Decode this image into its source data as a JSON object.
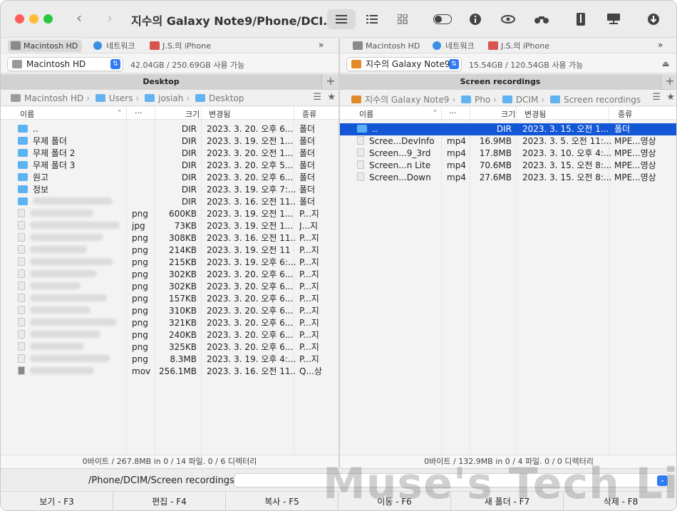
{
  "window": {
    "title": "지수의 Galaxy Note9/Phone/DCI..."
  },
  "colors": {
    "accent": "#1457d6",
    "folder": "#5cb3f2"
  },
  "toolbar": {
    "icons": [
      "list-view-icon",
      "detail-view-icon",
      "grid-view-icon",
      "toggle-icon",
      "info-icon",
      "eye-icon",
      "binoculars-icon",
      "archive-icon",
      "network-drive-icon",
      "download-icon"
    ]
  },
  "left": {
    "drives": [
      "Macintosh HD",
      "네트워크",
      "J.S.의 iPhone"
    ],
    "more": "»",
    "volume": "Macintosh HD",
    "space": "42.04GB / 250.69GB 사용 가능",
    "tab": "Desktop",
    "crumbs": [
      "Macintosh HD",
      "Users",
      "josiah",
      "Desktop"
    ],
    "headers": {
      "name": "이름",
      "ext": "···",
      "size": "크기",
      "modified": "변경됨",
      "kind": "종류"
    },
    "rows": [
      {
        "name": "..",
        "ext": "",
        "size": "DIR",
        "date": "2023. 3. 20. 오후 6...",
        "kind": "폴더",
        "type": "folder"
      },
      {
        "name": "무제 폴더",
        "ext": "",
        "size": "DIR",
        "date": "2023. 3. 19. 오전 1...",
        "kind": "폴더",
        "type": "folder"
      },
      {
        "name": "무제 폴더 2",
        "ext": "",
        "size": "DIR",
        "date": "2023. 3. 20. 오전 1...",
        "kind": "폴더",
        "type": "folder"
      },
      {
        "name": "무제 폴더 3",
        "ext": "",
        "size": "DIR",
        "date": "2023. 3. 20. 오후 5...",
        "kind": "폴더",
        "type": "folder"
      },
      {
        "name": "원고",
        "ext": "",
        "size": "DIR",
        "date": "2023. 3. 20. 오후 6...",
        "kind": "폴더",
        "type": "folder"
      },
      {
        "name": "정보",
        "ext": "",
        "size": "DIR",
        "date": "2023. 3. 19. 오후 7:...",
        "kind": "폴더",
        "type": "folder"
      },
      {
        "name": "",
        "ext": "",
        "size": "DIR",
        "date": "2023. 3. 16. 오전 11...",
        "kind": "폴더",
        "type": "folder-blur"
      },
      {
        "name": "",
        "ext": "png",
        "size": "600KB",
        "date": "2023. 3. 19. 오전 1...",
        "kind": "P...지",
        "type": "doc-blur"
      },
      {
        "name": "",
        "ext": "jpg",
        "size": "73KB",
        "date": "2023. 3. 19. 오전 1...",
        "kind": "J...지",
        "type": "doc-blur"
      },
      {
        "name": "",
        "ext": "png",
        "size": "308KB",
        "date": "2023. 3. 16. 오전 11...",
        "kind": "P...지",
        "type": "doc-blur"
      },
      {
        "name": "",
        "ext": "png",
        "size": "214KB",
        "date": "2023. 3. 19. 오전 11",
        "kind": "P...지",
        "type": "doc-blur"
      },
      {
        "name": "",
        "ext": "png",
        "size": "215KB",
        "date": "2023. 3. 19. 오후 6:...",
        "kind": "P...지",
        "type": "doc-blur"
      },
      {
        "name": "",
        "ext": "png",
        "size": "302KB",
        "date": "2023. 3. 20. 오후 6...",
        "kind": "P...지",
        "type": "doc-blur"
      },
      {
        "name": "",
        "ext": "png",
        "size": "302KB",
        "date": "2023. 3. 20. 오후 6...",
        "kind": "P...지",
        "type": "doc-blur"
      },
      {
        "name": "",
        "ext": "png",
        "size": "157KB",
        "date": "2023. 3. 20. 오후 6...",
        "kind": "P...지",
        "type": "doc-blur"
      },
      {
        "name": "",
        "ext": "png",
        "size": "310KB",
        "date": "2023. 3. 20. 오후 6...",
        "kind": "P...지",
        "type": "doc-blur"
      },
      {
        "name": "",
        "ext": "png",
        "size": "321KB",
        "date": "2023. 3. 20. 오후 6...",
        "kind": "P...지",
        "type": "doc-blur"
      },
      {
        "name": "",
        "ext": "png",
        "size": "240KB",
        "date": "2023. 3. 20. 오후 6...",
        "kind": "P...지",
        "type": "doc-blur"
      },
      {
        "name": "",
        "ext": "png",
        "size": "325KB",
        "date": "2023. 3. 20. 오후 6...",
        "kind": "P...지",
        "type": "doc-blur"
      },
      {
        "name": "",
        "ext": "png",
        "size": "8.3MB",
        "date": "2023. 3. 19. 오후 4:...",
        "kind": "P...지",
        "type": "doc-blur"
      },
      {
        "name": "",
        "ext": "mov",
        "size": "256.1MB",
        "date": "2023. 3. 16. 오전 11...",
        "kind": "Q...상",
        "type": "video-blur"
      }
    ],
    "status": "0바이트 / 267.8MB in 0 / 14 파일. 0 / 6 디렉터리"
  },
  "right": {
    "drives": [
      "Macintosh HD",
      "네트워크",
      "J.S.의 iPhone"
    ],
    "more": "»",
    "volume": "지수의 Galaxy Note9",
    "space": "15.54GB / 120.54GB 사용 가능",
    "eject": "⏏",
    "tab": "Screen recordings",
    "crumbs": [
      "지수의 Galaxy Note9",
      "Pho",
      "DCIM",
      "Screen recordings"
    ],
    "headers": {
      "name": "이름",
      "ext": "···",
      "size": "크기",
      "modified": "변경됨",
      "kind": "종류"
    },
    "rows": [
      {
        "name": "..",
        "ext": "",
        "size": "DIR",
        "date": "2023. 3. 15. 오전 1...",
        "kind": "폴더",
        "type": "folder",
        "selected": true
      },
      {
        "name": "Scree...DevInfo",
        "ext": "mp4",
        "size": "16.9MB",
        "date": "2023. 3. 5. 오전 11:...",
        "kind": "MPE...영상",
        "type": "doc"
      },
      {
        "name": "Screen...9_3rd",
        "ext": "mp4",
        "size": "17.8MB",
        "date": "2023. 3. 10. 오후 4:...",
        "kind": "MPE...영상",
        "type": "doc"
      },
      {
        "name": "Screen...n Lite",
        "ext": "mp4",
        "size": "70.6MB",
        "date": "2023. 3. 15. 오전 8:...",
        "kind": "MPE...영상",
        "type": "doc"
      },
      {
        "name": "Screen...Down",
        "ext": "mp4",
        "size": "27.6MB",
        "date": "2023. 3. 15. 오전 8:...",
        "kind": "MPE...영상",
        "type": "doc"
      }
    ],
    "status": "0바이트 / 132.9MB in 0 / 4 파일. 0 / 0 디렉터리"
  },
  "command": {
    "path": "/Phone/DCIM/Screen recordings"
  },
  "fkeys": [
    "보기 - F3",
    "편집 - F4",
    "복사 - F5",
    "이동 - F6",
    "새 폴더 - F7",
    "삭제 - F8"
  ],
  "watermark": "Muse's Tech Live"
}
